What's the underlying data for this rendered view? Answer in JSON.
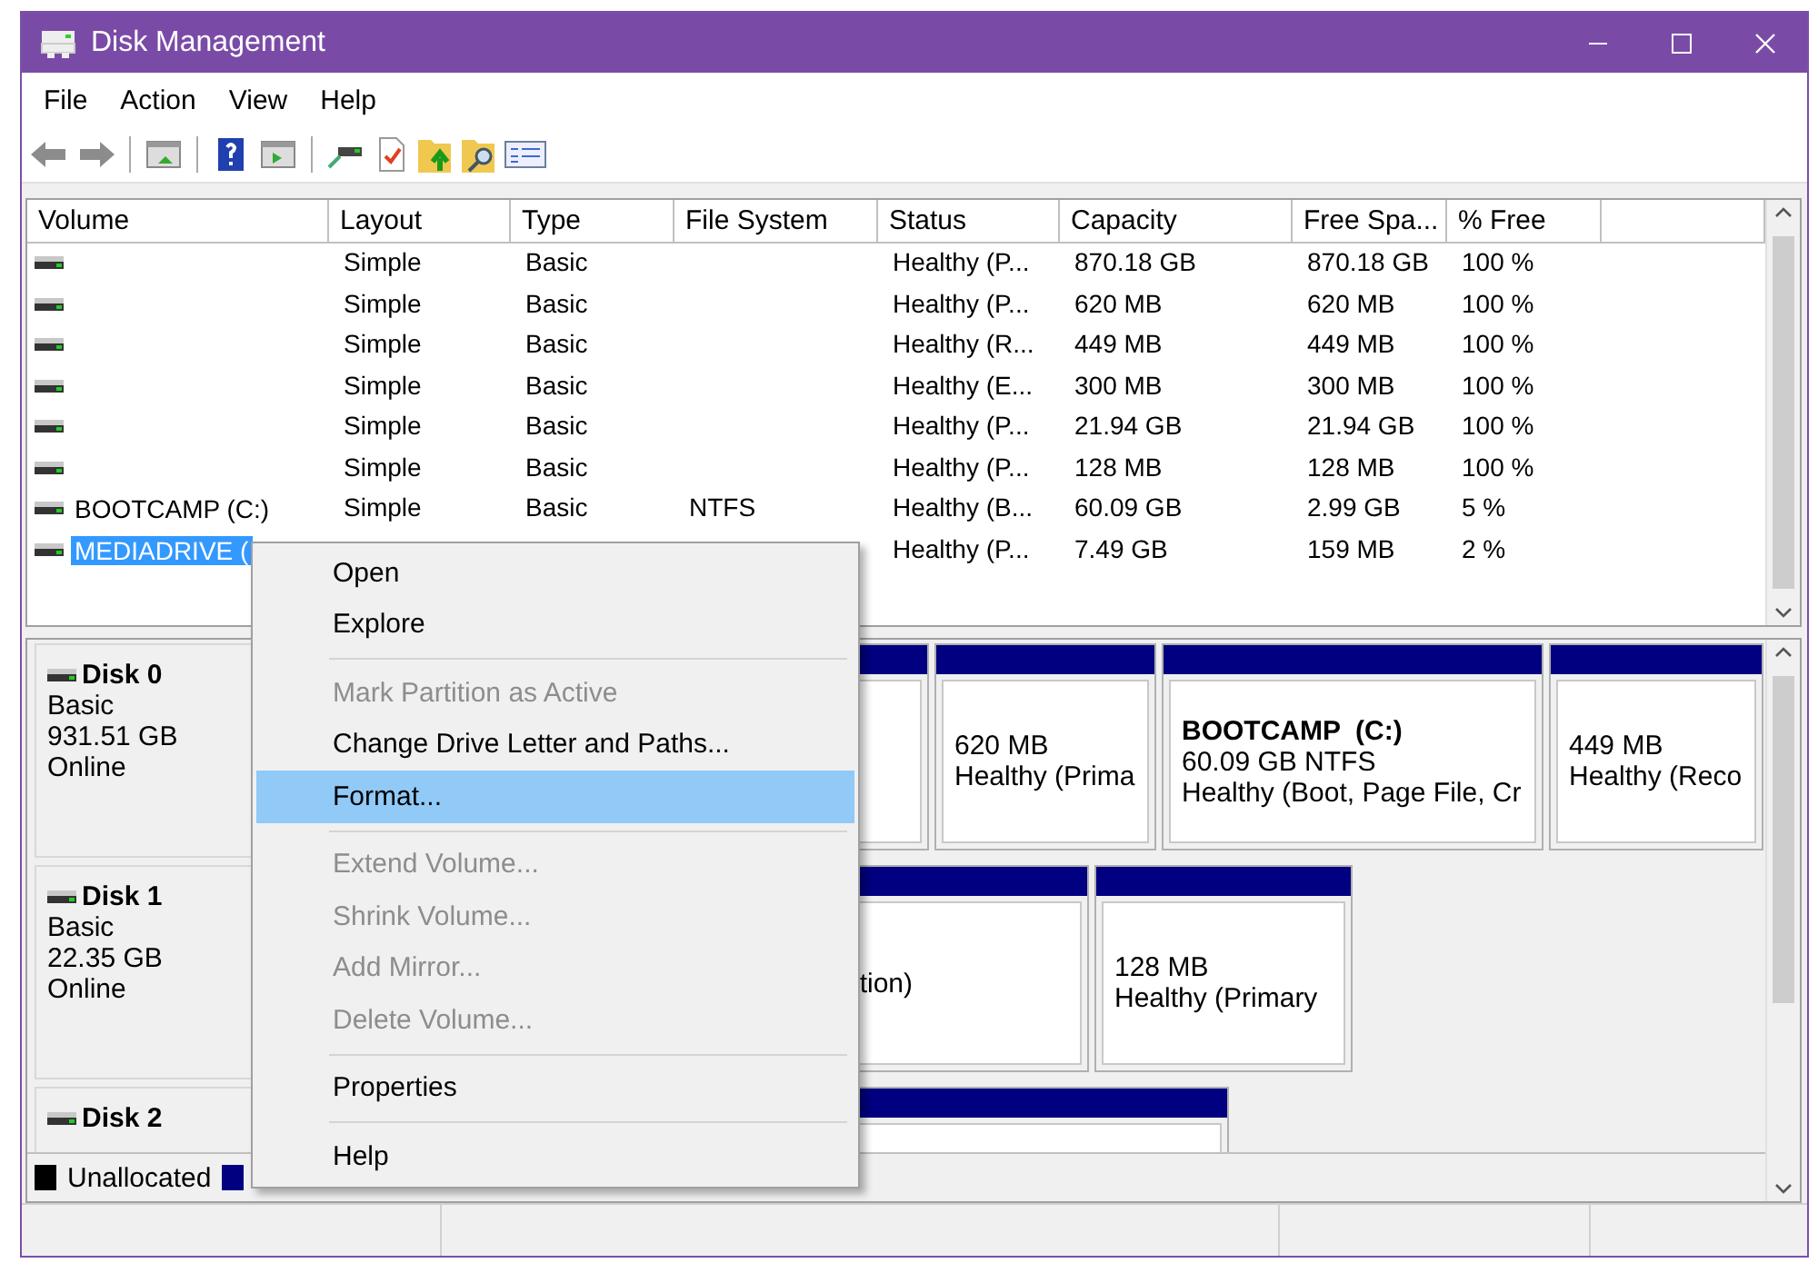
{
  "window": {
    "title": "Disk Management"
  },
  "menu_bar": [
    "File",
    "Action",
    "View",
    "Help"
  ],
  "toolbar": [
    {
      "kind": "back"
    },
    {
      "kind": "forward"
    },
    {
      "kind": "sep"
    },
    {
      "kind": "console"
    },
    {
      "kind": "sep"
    },
    {
      "kind": "help"
    },
    {
      "kind": "console-play"
    },
    {
      "kind": "sep"
    },
    {
      "kind": "connect"
    },
    {
      "kind": "check"
    },
    {
      "kind": "folder-up"
    },
    {
      "kind": "folder-search"
    },
    {
      "kind": "list"
    }
  ],
  "table": {
    "columns": [
      "Volume",
      "Layout",
      "Type",
      "File System",
      "Status",
      "Capacity",
      "Free Spa...",
      "% Free"
    ],
    "rows": [
      {
        "volume": "",
        "layout": "Simple",
        "type": "Basic",
        "file_system": "",
        "status": "Healthy (P...",
        "capacity": "870.18 GB",
        "free_space": "870.18 GB",
        "percent_free": "100 %",
        "selected": false
      },
      {
        "volume": "",
        "layout": "Simple",
        "type": "Basic",
        "file_system": "",
        "status": "Healthy (P...",
        "capacity": "620 MB",
        "free_space": "620 MB",
        "percent_free": "100 %",
        "selected": false
      },
      {
        "volume": "",
        "layout": "Simple",
        "type": "Basic",
        "file_system": "",
        "status": "Healthy (R...",
        "capacity": "449 MB",
        "free_space": "449 MB",
        "percent_free": "100 %",
        "selected": false
      },
      {
        "volume": "",
        "layout": "Simple",
        "type": "Basic",
        "file_system": "",
        "status": "Healthy (E...",
        "capacity": "300 MB",
        "free_space": "300 MB",
        "percent_free": "100 %",
        "selected": false
      },
      {
        "volume": "",
        "layout": "Simple",
        "type": "Basic",
        "file_system": "",
        "status": "Healthy (P...",
        "capacity": "21.94 GB",
        "free_space": "21.94 GB",
        "percent_free": "100 %",
        "selected": false
      },
      {
        "volume": "",
        "layout": "Simple",
        "type": "Basic",
        "file_system": "",
        "status": "Healthy (P...",
        "capacity": "128 MB",
        "free_space": "128 MB",
        "percent_free": "100 %",
        "selected": false
      },
      {
        "volume": "BOOTCAMP (C:)",
        "layout": "Simple",
        "type": "Basic",
        "file_system": "NTFS",
        "status": "Healthy (B...",
        "capacity": "60.09 GB",
        "free_space": "2.99 GB",
        "percent_free": "5 %",
        "selected": false
      },
      {
        "volume": "MEDIADRIVE (",
        "layout": "",
        "type": "",
        "file_system": "",
        "status": "Healthy (P...",
        "capacity": "7.49 GB",
        "free_space": "159 MB",
        "percent_free": "2 %",
        "selected": true
      }
    ]
  },
  "disks": [
    {
      "name": "Disk 0",
      "lines": [
        "Basic",
        "931.51 GB",
        "Online"
      ],
      "partitions": [
        {
          "kind": "plain"
        },
        {
          "kind": "plain",
          "lines": [
            "620 MB",
            "Healthy (Prima"
          ]
        },
        {
          "kind": "plain",
          "title": "BOOTCAMP  (C:)",
          "lines": [
            "60.09 GB NTFS",
            "Healthy (Boot, Page File, Cr"
          ]
        },
        {
          "kind": "plain",
          "lines": [
            "449 MB",
            "Healthy (Reco"
          ]
        }
      ]
    },
    {
      "name": "Disk 1",
      "lines": [
        "Basic",
        "22.35 GB",
        "Online"
      ],
      "partitions": [
        {
          "kind": "partial",
          "lines": [
            "tion)"
          ]
        },
        {
          "kind": "plain",
          "lines": [
            "128 MB",
            "Healthy (Primary"
          ]
        }
      ]
    },
    {
      "name": "Disk 2",
      "partitions": [
        {
          "kind": "plain"
        }
      ]
    }
  ],
  "legend": [
    {
      "label": "Unallocated",
      "color": "#000000"
    },
    {
      "color": "#000080"
    }
  ],
  "context_menu": [
    {
      "kind": "item",
      "label": "Open",
      "disabled": false,
      "selected": false
    },
    {
      "kind": "item",
      "label": "Explore",
      "disabled": false,
      "selected": false
    },
    {
      "kind": "separator"
    },
    {
      "kind": "item",
      "label": "Mark Partition as Active",
      "disabled": true,
      "selected": false
    },
    {
      "kind": "item",
      "label": "Change Drive Letter and Paths...",
      "disabled": false,
      "selected": false
    },
    {
      "kind": "item",
      "label": "Format...",
      "disabled": false,
      "selected": true
    },
    {
      "kind": "separator"
    },
    {
      "kind": "item",
      "label": "Extend Volume...",
      "disabled": true,
      "selected": false
    },
    {
      "kind": "item",
      "label": "Shrink Volume...",
      "disabled": true,
      "selected": false
    },
    {
      "kind": "item",
      "label": "Add Mirror...",
      "disabled": true,
      "selected": false
    },
    {
      "kind": "item",
      "label": "Delete Volume...",
      "disabled": true,
      "selected": false
    },
    {
      "kind": "separator"
    },
    {
      "kind": "item",
      "label": "Properties",
      "disabled": false,
      "selected": false
    },
    {
      "kind": "separator"
    },
    {
      "kind": "item",
      "label": "Help",
      "disabled": false,
      "selected": false
    }
  ]
}
